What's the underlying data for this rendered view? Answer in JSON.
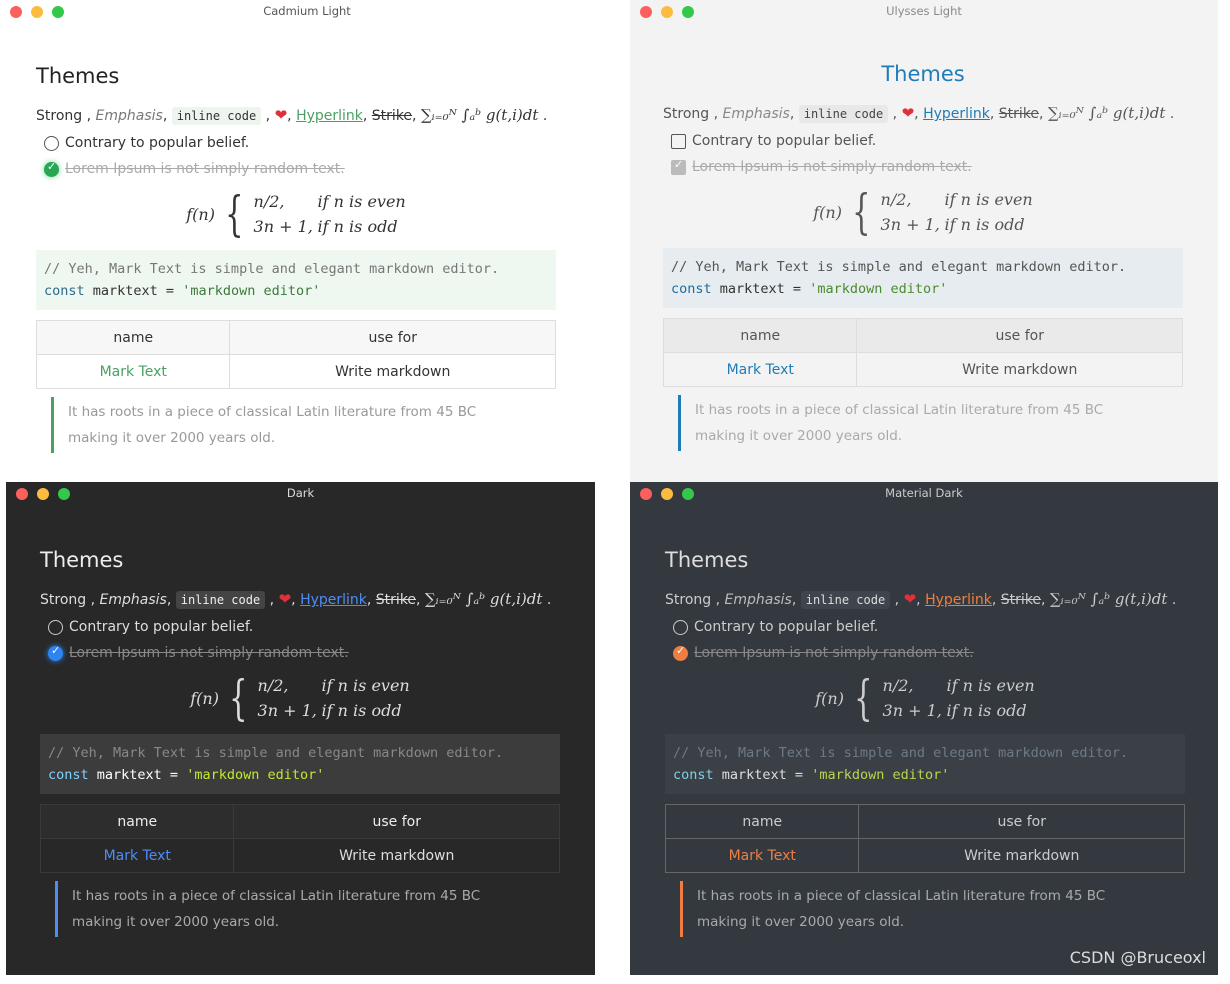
{
  "windows": [
    {
      "title": "Cadmium Light",
      "heading": "Themes",
      "strong": "Strong",
      "emphasis": "Emphasis",
      "inline_code": "inline code",
      "hyperlink": "Hyperlink",
      "strike": "Strike",
      "task_1": "Contrary to popular belief.",
      "task_2": "Lorem Ipsum is not simply random text.",
      "code_comment": "// Yeh, Mark Text is simple and elegant markdown editor.",
      "code_keyword": "const",
      "code_ident": "marktext =",
      "code_string": "'markdown editor'",
      "table_headers": [
        "name",
        "use for"
      ],
      "table_row": [
        "Mark Text",
        "Write markdown"
      ],
      "quote_1": "It has roots in a piece of classical Latin literature from 45 BC",
      "quote_2": "making it over 2000 years old."
    },
    {
      "title": "Ulysses Light",
      "heading": "Themes",
      "strong": "Strong",
      "emphasis": "Emphasis",
      "inline_code": "inline code",
      "hyperlink": "Hyperlink",
      "strike": "Strike",
      "task_1": "Contrary to popular belief.",
      "task_2": "Lorem Ipsum is not simply random text.",
      "code_comment": "// Yeh, Mark Text is simple and elegant markdown editor.",
      "code_keyword": "const",
      "code_ident": "marktext =",
      "code_string": "'markdown editor'",
      "table_headers": [
        "name",
        "use for"
      ],
      "table_row": [
        "Mark Text",
        "Write markdown"
      ],
      "quote_1": "It has roots in a piece of classical Latin literature from 45 BC",
      "quote_2": "making it over 2000 years old."
    },
    {
      "title": "Dark",
      "heading": "Themes",
      "strong": "Strong",
      "emphasis": "Emphasis",
      "inline_code": "inline code",
      "hyperlink": "Hyperlink",
      "strike": "Strike",
      "task_1": "Contrary to popular belief.",
      "task_2": "Lorem Ipsum is not simply random text.",
      "code_comment": "// Yeh, Mark Text is simple and elegant markdown editor.",
      "code_keyword": "const",
      "code_ident": "marktext =",
      "code_string": "'markdown editor'",
      "table_headers": [
        "name",
        "use for"
      ],
      "table_row": [
        "Mark Text",
        "Write markdown"
      ],
      "quote_1": "It has roots in a piece of classical Latin literature from 45 BC",
      "quote_2": "making it over 2000 years old."
    },
    {
      "title": "Material Dark",
      "heading": "Themes",
      "strong": "Strong",
      "emphasis": "Emphasis",
      "inline_code": "inline code",
      "hyperlink": "Hyperlink",
      "strike": "Strike",
      "task_1": "Contrary to popular belief.",
      "task_2": "Lorem Ipsum is not simply random text.",
      "code_comment": "// Yeh, Mark Text is simple and elegant markdown editor.",
      "code_keyword": "const",
      "code_ident": "marktext =",
      "code_string": "'markdown editor'",
      "table_headers": [
        "name",
        "use for"
      ],
      "table_row": [
        "Mark Text",
        "Write markdown"
      ],
      "quote_1": "It has roots in a piece of classical Latin literature from 45 BC",
      "quote_2": "making it over 2000 years old."
    }
  ],
  "math_inline": "∑ᵢ₌₀ᴺ ∫ₐᵇ g(t,i)dt",
  "formula_lhs": "f(n)",
  "formula_case1_expr": "n/2,",
  "formula_case1_cond": "if n is even",
  "formula_case2_expr": "3n + 1,",
  "formula_case2_cond": "if n is odd",
  "icons": [
    "heart-icon",
    "checkbox-icon",
    "checked-checkbox-icon"
  ],
  "theme_colors": {
    "cadmium_accent": "#4aa162",
    "ulysses_accent": "#1e7cb7",
    "dark_accent": "#4e8df5",
    "material_accent": "#ef7f41"
  },
  "watermark": "CSDN @Bruceoxl"
}
